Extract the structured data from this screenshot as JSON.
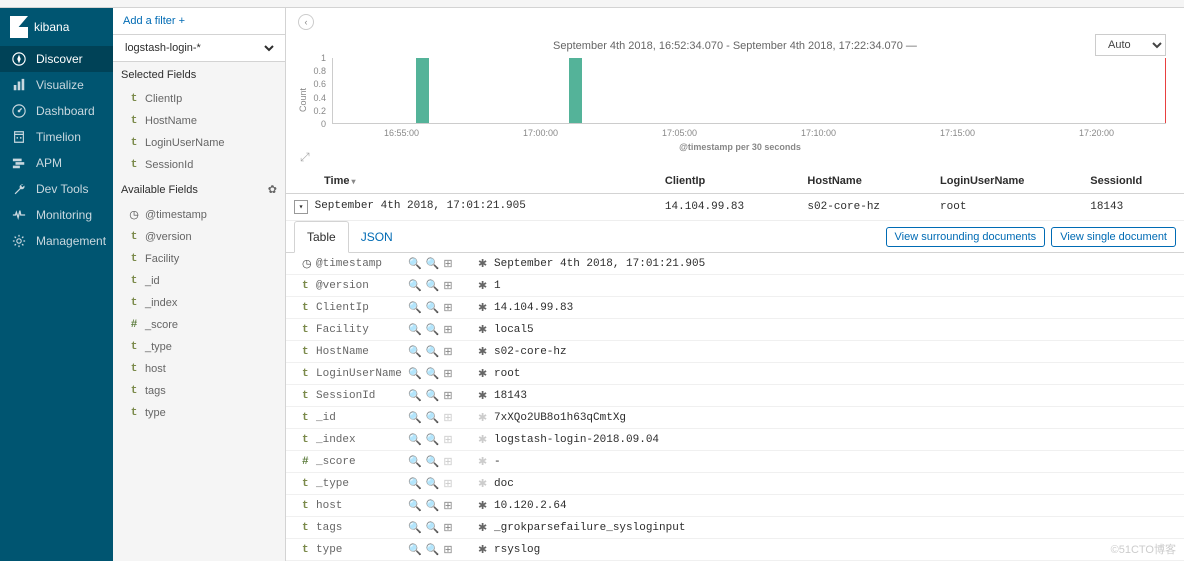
{
  "brand": {
    "name": "kibana"
  },
  "nav": {
    "items": [
      {
        "label": "Discover",
        "icon": "compass",
        "active": true
      },
      {
        "label": "Visualize",
        "icon": "bar-chart"
      },
      {
        "label": "Dashboard",
        "icon": "gauge"
      },
      {
        "label": "Timelion",
        "icon": "shield"
      },
      {
        "label": "APM",
        "icon": "apm"
      },
      {
        "label": "Dev Tools",
        "icon": "wrench"
      },
      {
        "label": "Monitoring",
        "icon": "heartbeat"
      },
      {
        "label": "Management",
        "icon": "gear"
      }
    ]
  },
  "filter": {
    "add_label": "Add a filter",
    "plus": "+"
  },
  "index_pattern": {
    "selected": "logstash-login-*"
  },
  "fields": {
    "selected_label": "Selected Fields",
    "available_label": "Available Fields",
    "selected": [
      {
        "type": "t",
        "name": "ClientIp"
      },
      {
        "type": "t",
        "name": "HostName"
      },
      {
        "type": "t",
        "name": "LoginUserName"
      },
      {
        "type": "t",
        "name": "SessionId"
      }
    ],
    "available": [
      {
        "type": "clock",
        "name": "@timestamp"
      },
      {
        "type": "t",
        "name": "@version"
      },
      {
        "type": "t",
        "name": "Facility"
      },
      {
        "type": "t",
        "name": "_id"
      },
      {
        "type": "t",
        "name": "_index"
      },
      {
        "type": "#",
        "name": "_score"
      },
      {
        "type": "t",
        "name": "_type"
      },
      {
        "type": "t",
        "name": "host"
      },
      {
        "type": "t",
        "name": "tags"
      },
      {
        "type": "t",
        "name": "type"
      }
    ]
  },
  "time": {
    "range": "September 4th 2018, 16:52:34.070 - September 4th 2018, 17:22:34.070 —",
    "interval": "Auto"
  },
  "chart_data": {
    "type": "bar",
    "ylabel": "Count",
    "xlabel": "@timestamp per 30 seconds",
    "y_ticks": [
      "0",
      "0.2",
      "0.4",
      "0.6",
      "0.8",
      "1"
    ],
    "ylim": [
      0,
      1
    ],
    "x_ticks": [
      "16:55:00",
      "17:00:00",
      "17:05:00",
      "17:10:00",
      "17:15:00",
      "17:20:00"
    ],
    "x_range_minutes": [
      52.5,
      22.5
    ],
    "bars": [
      {
        "x_minute_offset": 3.0,
        "value": 1
      },
      {
        "x_minute_offset": 8.5,
        "value": 1
      }
    ]
  },
  "columns": {
    "time": "Time",
    "client_ip": "ClientIp",
    "hostname": "HostName",
    "login_user": "LoginUserName",
    "session_id": "SessionId"
  },
  "rows": [
    {
      "time": "September 4th 2018, 17:01:21.905",
      "client_ip": "14.104.99.83",
      "hostname": "s02-core-hz",
      "login_user": "root",
      "session_id": "18143"
    }
  ],
  "detail": {
    "tabs": {
      "table": "Table",
      "json": "JSON"
    },
    "actions": {
      "surrounding": "View surrounding documents",
      "single": "View single document"
    },
    "fields": [
      {
        "type": "clock",
        "name": "@timestamp",
        "value": "September 4th 2018, 17:01:21.905",
        "star": true
      },
      {
        "type": "t",
        "name": "@version",
        "value": "1",
        "star": true
      },
      {
        "type": "t",
        "name": "ClientIp",
        "value": "14.104.99.83",
        "star": true
      },
      {
        "type": "t",
        "name": "Facility",
        "value": "local5",
        "star": true
      },
      {
        "type": "t",
        "name": "HostName",
        "value": "s02-core-hz",
        "star": true
      },
      {
        "type": "t",
        "name": "LoginUserName",
        "value": "root",
        "star": true
      },
      {
        "type": "t",
        "name": "SessionId",
        "value": "18143",
        "star": true
      },
      {
        "type": "t",
        "name": "_id",
        "value": "7xXQo2UB8o1h63qCmtXg",
        "star": false,
        "dim_actions": true
      },
      {
        "type": "t",
        "name": "_index",
        "value": "logstash-login-2018.09.04",
        "star": false,
        "dim_actions": true
      },
      {
        "type": "#",
        "name": "_score",
        "value": "-",
        "star": false,
        "dim_actions": true,
        "all_dim": true
      },
      {
        "type": "t",
        "name": "_type",
        "value": "doc",
        "star": false,
        "dim_actions": true
      },
      {
        "type": "t",
        "name": "host",
        "value": "10.120.2.64",
        "star": true
      },
      {
        "type": "t",
        "name": "tags",
        "value": "_grokparsefailure_sysloginput",
        "star": true
      },
      {
        "type": "t",
        "name": "type",
        "value": "rsyslog",
        "star": true
      }
    ]
  },
  "watermark": "©51CTO博客"
}
